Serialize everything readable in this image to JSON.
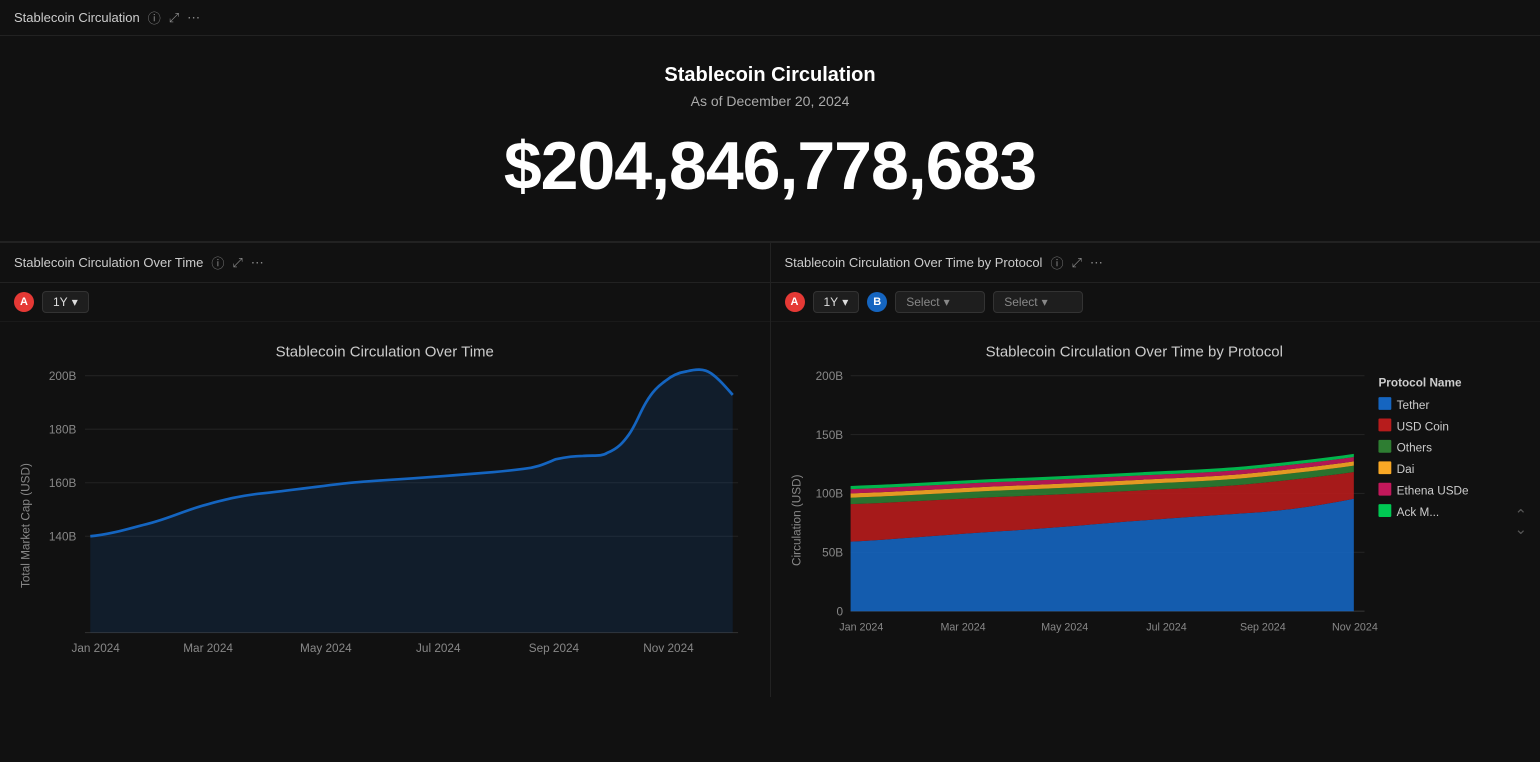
{
  "topPanel": {
    "headerTitle": "Stablecoin Circulation",
    "chartTitle": "Stablecoin Circulation",
    "subtitle": "As of December 20, 2024",
    "bigNumber": "$204,846,778,683"
  },
  "leftChart": {
    "title": "Stablecoin Circulation Over Time",
    "chartTitle": "Stablecoin Circulation Over Time",
    "timeOptions": [
      "1Y"
    ],
    "selectedTime": "1Y",
    "yAxisLabel": "Total Market Cap (USD)",
    "yAxisValues": [
      "200B",
      "180B",
      "160B",
      "140B"
    ],
    "xAxisValues": [
      "Jan 2024",
      "Mar 2024",
      "May 2024",
      "Jul 2024",
      "Sep 2024",
      "Nov 2024"
    ],
    "badgeA": "A"
  },
  "rightChart": {
    "title": "Stablecoin Circulation Over Time by Protocol",
    "chartTitle": "Stablecoin Circulation Over Time by Protocol",
    "timeOptions": [
      "1Y"
    ],
    "selectedTime": "1Y",
    "selectA": "Select",
    "selectB": "Select",
    "badgeA": "A",
    "badgeB": "B",
    "yAxisLabel": "Circulation (USD)",
    "yAxisValues": [
      "200B",
      "150B",
      "100B",
      "50B",
      "0"
    ],
    "xAxisValues": [
      "Jan 2024",
      "Mar 2024",
      "May 2024",
      "Jul 2024",
      "Sep 2024",
      "Nov 2024"
    ],
    "legend": {
      "title": "Protocol Name",
      "items": [
        {
          "label": "Tether",
          "color": "#1565c0"
        },
        {
          "label": "USD Coin",
          "color": "#b71c1c"
        },
        {
          "label": "Others",
          "color": "#2e7d32"
        },
        {
          "label": "Dai",
          "color": "#f9a825"
        },
        {
          "label": "Ethena USDe",
          "color": "#c2185b"
        },
        {
          "label": "Ack M...",
          "color": "#00c853"
        }
      ]
    }
  },
  "icons": {
    "info": "ⓘ",
    "expand": "⤢",
    "more": "⋯",
    "chevronDown": "▾"
  }
}
